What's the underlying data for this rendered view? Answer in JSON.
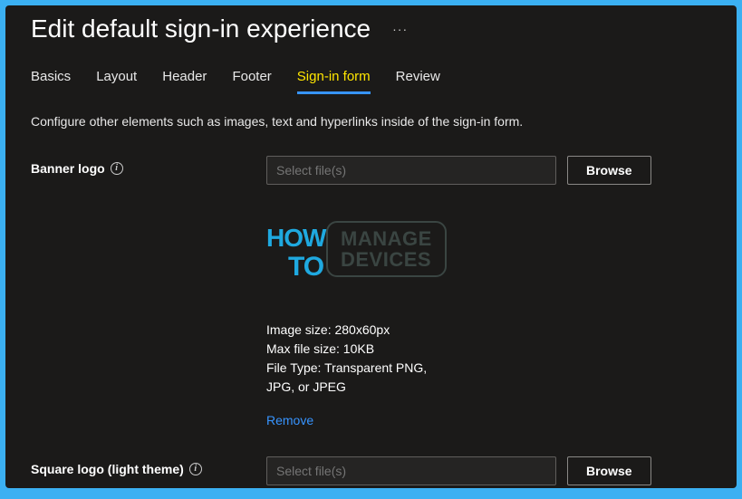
{
  "header": {
    "title": "Edit default sign-in experience",
    "more": "···"
  },
  "tabs": [
    {
      "id": "basics",
      "label": "Basics"
    },
    {
      "id": "layout",
      "label": "Layout"
    },
    {
      "id": "header",
      "label": "Header"
    },
    {
      "id": "footer",
      "label": "Footer"
    },
    {
      "id": "signin",
      "label": "Sign-in form"
    },
    {
      "id": "review",
      "label": "Review"
    }
  ],
  "activeTab": "signin",
  "description": "Configure other elements such as images, text and hyperlinks inside of the sign-in form.",
  "bannerLogo": {
    "label": "Banner logo",
    "placeholder": "Select file(s)",
    "browse": "Browse",
    "specs": {
      "line1": "Image size: 280x60px",
      "line2": "Max file size: 10KB",
      "line3": "File Type: Transparent PNG,",
      "line4": "JPG, or JPEG"
    },
    "removeLabel": "Remove",
    "preview": {
      "how": "HOW",
      "to": "TO",
      "manage": "MANAGE",
      "devices": "DEVICES"
    }
  },
  "squareLogo": {
    "label": "Square logo (light theme)",
    "placeholder": "Select file(s)",
    "browse": "Browse"
  },
  "infoGlyph": "i"
}
